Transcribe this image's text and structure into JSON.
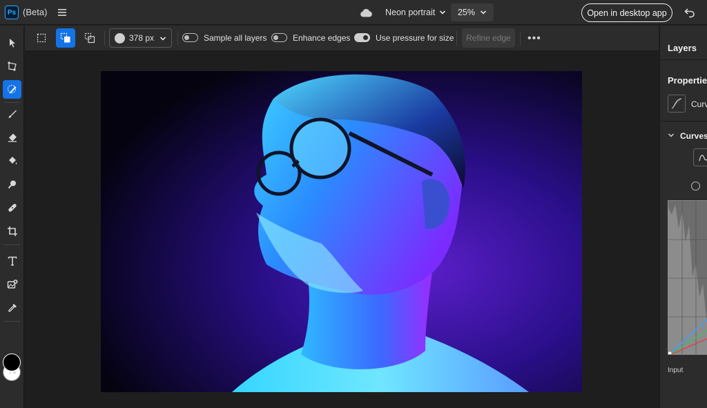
{
  "app": {
    "logo_text": "Ps",
    "beta_label": "(Beta)",
    "document_title": "Neon portrait",
    "zoom_level": "25%",
    "open_desktop_label": "Open in desktop app"
  },
  "tools": [
    {
      "name": "move-tool",
      "icon": "arrow-pointer-icon"
    },
    {
      "name": "transform-tool",
      "icon": "transform-icon"
    },
    {
      "name": "quick-selection-tool",
      "icon": "quick-selection-brush-icon",
      "active": true
    },
    {
      "name": "brush-tool",
      "icon": "brush-icon"
    },
    {
      "name": "eraser-tool",
      "icon": "eraser-icon"
    },
    {
      "name": "paint-bucket-tool",
      "icon": "paint-bucket-icon"
    },
    {
      "name": "spot-heal-tool",
      "icon": "spot-heal-icon"
    },
    {
      "name": "clone-stamp-tool",
      "icon": "bandage-icon"
    },
    {
      "name": "crop-tool",
      "icon": "crop-icon"
    },
    {
      "name": "type-tool",
      "icon": "type-icon"
    },
    {
      "name": "add-image-tool",
      "icon": "add-image-icon"
    },
    {
      "name": "eyedropper-tool",
      "icon": "eyedropper-icon"
    },
    {
      "name": "swap-colors",
      "icon": "swap-arrows-icon"
    }
  ],
  "colors": {
    "foreground": "#000000",
    "background": "#ffffff",
    "accent": "#1473e6"
  },
  "options": {
    "brush_size": "378 px",
    "sample_all_layers_label": "Sample all layers",
    "sample_all_layers_on": false,
    "enhance_edges_label": "Enhance edges",
    "enhance_edges_on": false,
    "use_pressure_label": "Use pressure for size",
    "use_pressure_on": true,
    "refine_edge_label": "Refine edge",
    "more_label": "•••"
  },
  "panel": {
    "layers_title": "Layers",
    "properties_title": "Properties",
    "curves_item_label": "Curv",
    "curves_section_label": "Curves",
    "input_label": "Input"
  }
}
